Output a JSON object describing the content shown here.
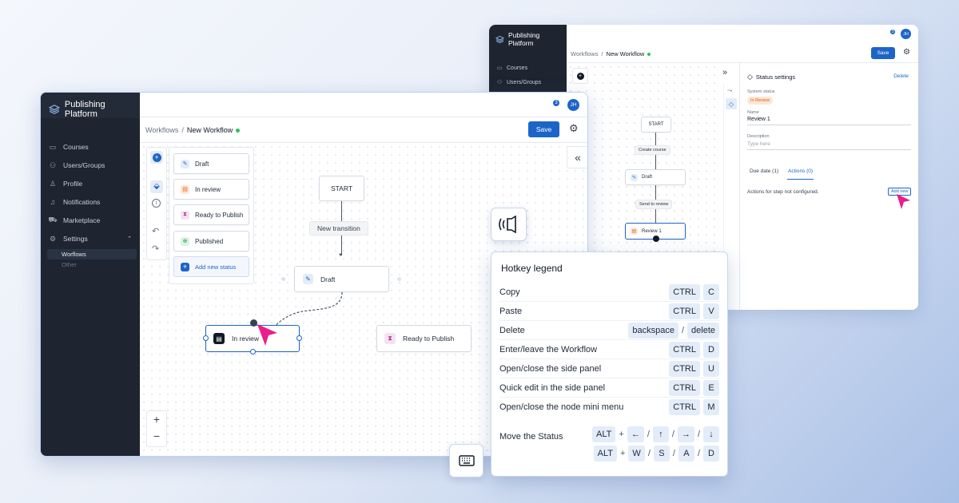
{
  "brand": {
    "name": "Publishing Platform"
  },
  "nav": {
    "items": [
      {
        "label": "Courses",
        "icon": "book-icon"
      },
      {
        "label": "Users/Groups",
        "icon": "users-icon"
      },
      {
        "label": "Profile",
        "icon": "user-icon"
      },
      {
        "label": "Notifications",
        "icon": "bell-icon"
      },
      {
        "label": "Marketplace",
        "icon": "cart-icon"
      },
      {
        "label": "Settings",
        "icon": "gear-icon"
      }
    ],
    "sub_items": [
      "Worflows",
      "Other"
    ]
  },
  "header": {
    "notifications_count": "3",
    "avatar_initials": "JH"
  },
  "breadcrumb": {
    "parent": "Workflows",
    "separator": "/",
    "current": "New Workflow"
  },
  "toolbar": {
    "save_label": "Save"
  },
  "status_panel": {
    "items": [
      "Draft",
      "In review",
      "Ready to Publish",
      "Published"
    ],
    "add_label": "Add new status"
  },
  "flow": {
    "start": "START",
    "transition": "New transition",
    "draft": "Draft",
    "in_review": "In review",
    "ready": "Ready to Publish"
  },
  "zoom": {
    "in": "+",
    "out": "−"
  },
  "collapse_symbol": "«",
  "expand_symbol": "»",
  "hotkeys": {
    "title": "Hotkey legend",
    "rows": [
      {
        "action": "Copy",
        "keys": [
          "CTRL",
          "C"
        ]
      },
      {
        "action": "Paste",
        "keys": [
          "CTRL",
          "V"
        ]
      },
      {
        "action": "Enter/leave the Workflow",
        "keys": [
          "CTRL",
          "D"
        ]
      },
      {
        "action": "Open/close the side panel",
        "keys": [
          "CTRL",
          "U"
        ]
      },
      {
        "action": "Quick edit in the side panel",
        "keys": [
          "CTRL",
          "E"
        ]
      },
      {
        "action": "Open/close the node mini menu",
        "keys": [
          "CTRL",
          "M"
        ]
      }
    ],
    "delete": {
      "action": "Delete",
      "key1": "backspace",
      "sep": "/",
      "key2": "delete"
    },
    "move": {
      "action": "Move the Status",
      "mod": "ALT",
      "plus": "+",
      "sep": "/",
      "arrows": [
        "←",
        "↑",
        "→",
        "↓"
      ],
      "letters": [
        "W",
        "S",
        "A",
        "D"
      ]
    }
  },
  "back": {
    "flow": {
      "start": "START",
      "t1": "Create course",
      "draft": "Draft",
      "t2": "Send to review",
      "review": "Review 1"
    },
    "status_settings": {
      "title": "Status settings",
      "delete": "Delete",
      "system_status_label": "System status",
      "system_status_value": "In Review",
      "name_label": "Name",
      "name_value": "Review 1",
      "description_label": "Description",
      "description_placeholder": "Type here",
      "tab_due": "Due date (1)",
      "tab_actions": "Actions (0)",
      "empty_msg": "Actions for step not configured.",
      "add_new": "Add new"
    }
  },
  "colors": {
    "accent": "#1d64c8",
    "sidebar": "#1e2531",
    "pointer": "#e91e8c",
    "success": "#22c55e"
  }
}
